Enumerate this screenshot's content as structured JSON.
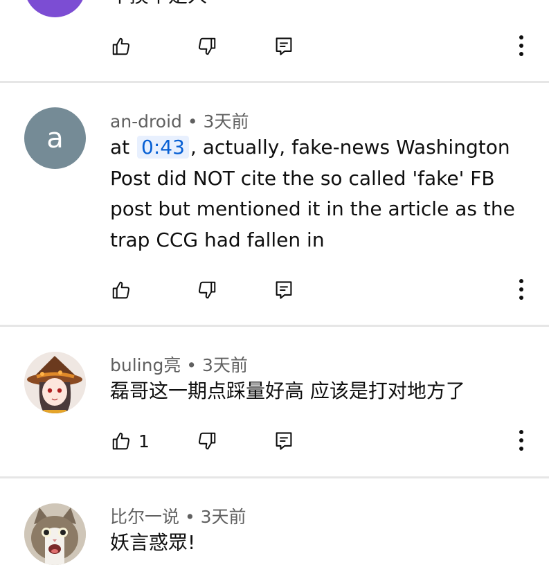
{
  "colors": {
    "accent": "#065fd4",
    "meta_text": "#606060",
    "divider": "#e6e6e6"
  },
  "comments": [
    {
      "author": "",
      "time": "",
      "text_lines": [
        "不摸不是人"
      ],
      "avatar": {
        "type": "color",
        "color": "#7c4dd3"
      },
      "likes": ""
    },
    {
      "author": "an-droid",
      "time": "3天前",
      "text_prefix": "at",
      "timestamp_link": "0:43",
      "text_lines": [
        ", actually, fake-news Washington",
        "Post did NOT cite the so called 'fake' FB",
        "post but mentioned it in the article as the",
        "trap CCG had fallen in"
      ],
      "avatar": {
        "type": "letter",
        "letter": "a",
        "color": "#758b96"
      },
      "likes": ""
    },
    {
      "author": "buling亮",
      "time": "3天前",
      "text_lines": [
        "磊哥这一期点踩量好高 应该是打对地方了"
      ],
      "avatar": {
        "type": "image",
        "icon": "anime-girl-witch-hat-avatar"
      },
      "likes": "1"
    },
    {
      "author": "比尔一说",
      "time": "3天前",
      "text_lines": [
        "妖言惑眾!"
      ],
      "avatar": {
        "type": "image",
        "icon": "cat-avatar"
      },
      "likes": ""
    }
  ],
  "separator": " • ",
  "icons": {
    "like": "thumbs-up-icon",
    "dislike": "thumbs-down-icon",
    "reply": "reply-icon",
    "more": "more-vert-icon"
  }
}
